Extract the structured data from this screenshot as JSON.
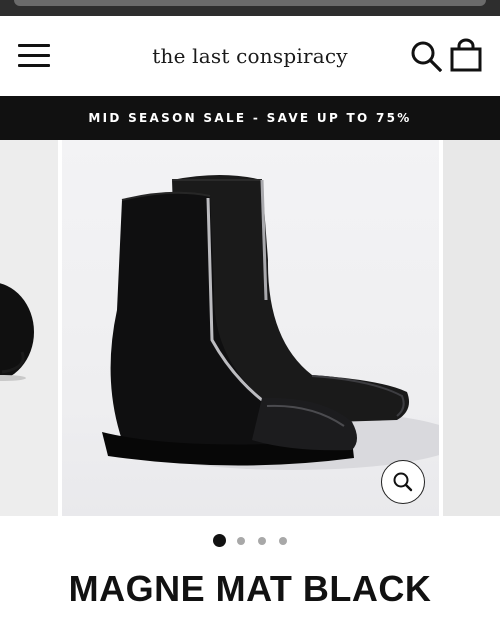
{
  "store": {
    "name": "the last conspiracy"
  },
  "header": {
    "menu_icon": "hamburger-menu-icon",
    "search_icon": "search-icon",
    "cart_icon": "shopping-bag-icon"
  },
  "promo": {
    "text": "MID SEASON SALE - SAVE UP TO 75%"
  },
  "gallery": {
    "slide_count": 4,
    "active_index": 0,
    "zoom_icon": "zoom-in-icon"
  },
  "product": {
    "title": "MAGNE MAT BLACK"
  },
  "colors": {
    "promo_bg": "#111111",
    "promo_text": "#ffffff",
    "dot_active": "#111111",
    "dot_inactive": "#a8a8a8"
  }
}
